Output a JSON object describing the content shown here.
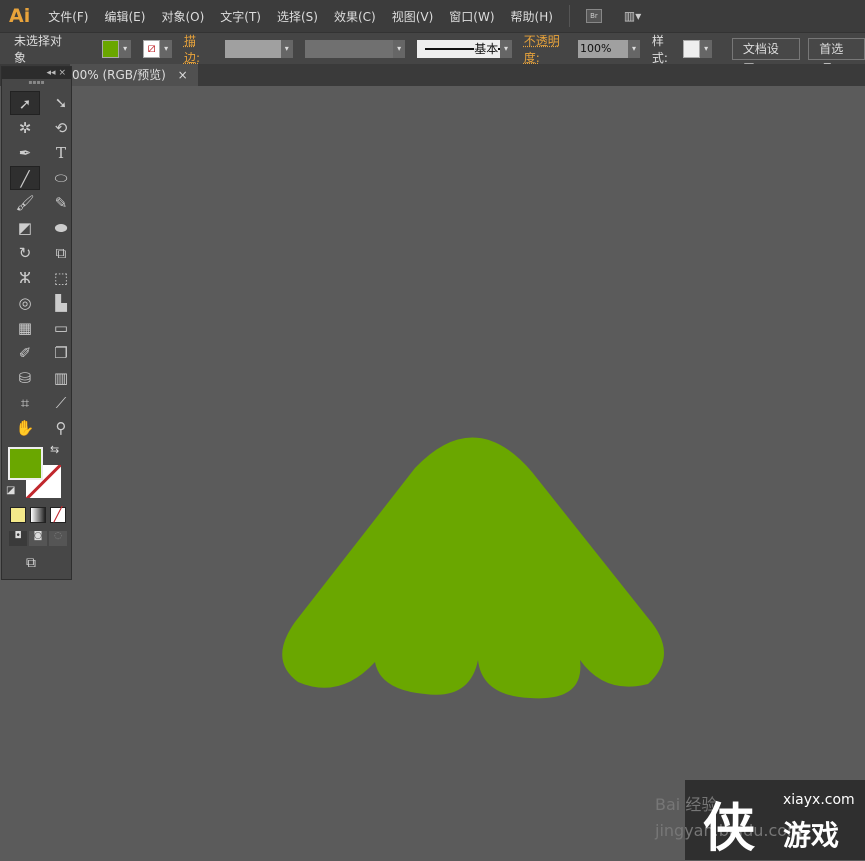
{
  "app": {
    "logo": "Ai",
    "menus": [
      "文件(F)",
      "编辑(E)",
      "对象(O)",
      "文字(T)",
      "选择(S)",
      "效果(C)",
      "视图(V)",
      "窗口(W)",
      "帮助(H)"
    ],
    "bridge": "Br"
  },
  "control": {
    "selection": "未选择对象",
    "fill_color": "#6aa700",
    "stroke_label": "描边:",
    "stroke_profile": "基本",
    "opacity_label": "不透明度:",
    "opacity": "100%",
    "style_label": "样式:",
    "doc_setup": "文档设置",
    "prefs": "首选项"
  },
  "document": {
    "tab_title": "00% (RGB/预览)",
    "close": "×"
  },
  "toolbox": {
    "collapse": "◂◂",
    "close": "×"
  },
  "artwork": {
    "fill": "#6aa700"
  },
  "watermark": {
    "site": "xiayx.com",
    "name": "游戏",
    "baidu": "Bai 经验 jingyan.baidu.com"
  }
}
